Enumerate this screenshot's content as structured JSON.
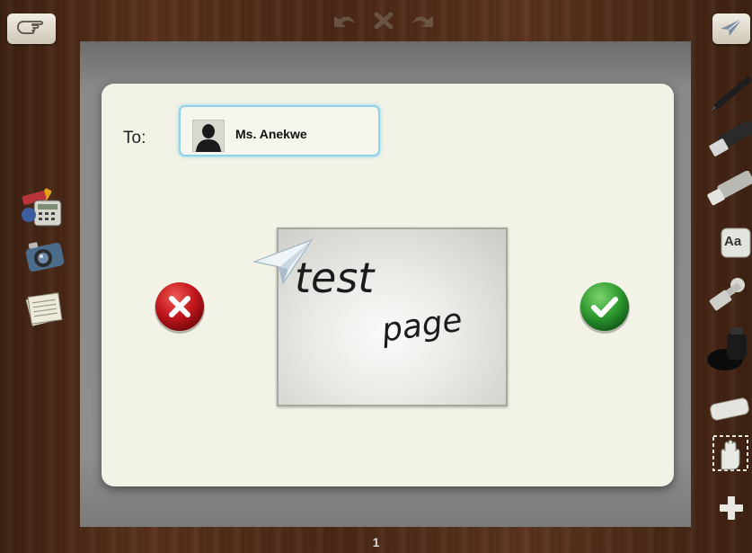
{
  "top_bar": {
    "icons": [
      "pointer-hand-icon",
      "undo-icon",
      "clear-icon",
      "redo-icon",
      "send-paper-plane-icon"
    ]
  },
  "left_toolbar": {
    "icons": [
      "calculator-tools-icon",
      "camera-icon",
      "notepad-icon"
    ]
  },
  "right_toolbar": {
    "icons": [
      "pen-icon",
      "marker-icon",
      "highlighter-icon",
      "text-tool-icon",
      "stamp-icon",
      "ink-bottle-icon",
      "eraser-icon",
      "hand-select-icon",
      "add-page-icon"
    ],
    "text_tool_label": "Aa"
  },
  "dialog": {
    "to_label": "To:",
    "recipient_name": "Ms. Anekwe",
    "preview": {
      "line1": "test",
      "line2": "page"
    },
    "cancel_icon": "close-x-icon",
    "confirm_icon": "checkmark-icon",
    "colors": {
      "cancel": "#c0151b",
      "confirm": "#2f9a2f",
      "recipient_border": "#8fd3ea",
      "dialog_bg": "#f2f2e6"
    }
  },
  "footer": {
    "page_number": "1"
  }
}
